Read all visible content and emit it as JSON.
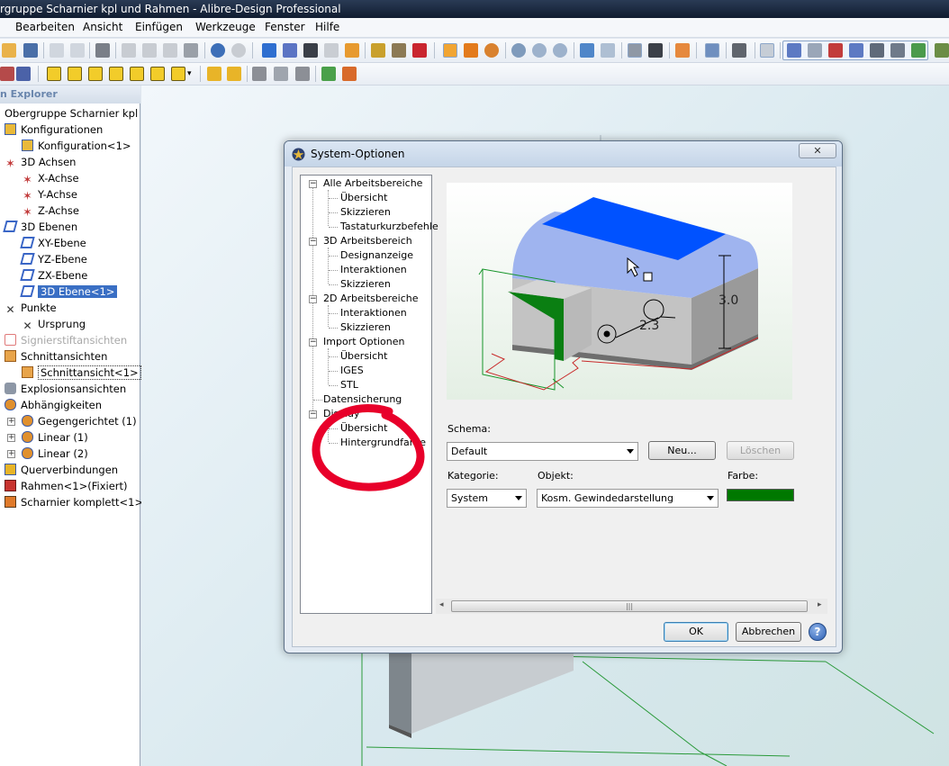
{
  "app": {
    "title": "rgruppe Scharnier kpl und Rahmen - Alibre-Design Professional"
  },
  "menu": [
    "Bearbeiten",
    "Ansicht",
    "Einfügen",
    "Werkzeuge",
    "Fenster",
    "Hilfe"
  ],
  "explorer": {
    "header": "n Explorer",
    "items": [
      {
        "label": "Obergruppe Scharnier kpl und",
        "icon": "none",
        "level": 0
      },
      {
        "label": "Konfigurationen",
        "icon": "configurations-icon",
        "level": 0
      },
      {
        "label": "Konfiguration<1>",
        "icon": "configuration-icon",
        "level": 1
      },
      {
        "label": "3D Achsen",
        "icon": "axes-icon",
        "level": 0
      },
      {
        "label": "X-Achse",
        "icon": "axis-icon",
        "level": 1
      },
      {
        "label": "Y-Achse",
        "icon": "axis-icon",
        "level": 1
      },
      {
        "label": "Z-Achse",
        "icon": "axis-icon",
        "level": 1
      },
      {
        "label": "3D Ebenen",
        "icon": "planes-icon",
        "level": 0
      },
      {
        "label": "XY-Ebene",
        "icon": "plane-icon",
        "level": 1
      },
      {
        "label": "YZ-Ebene",
        "icon": "plane-icon",
        "level": 1
      },
      {
        "label": "ZX-Ebene",
        "icon": "plane-icon",
        "level": 1
      },
      {
        "label": "3D Ebene<1>",
        "icon": "plane-icon",
        "level": 1
      },
      {
        "label": "Punkte",
        "icon": "points-icon",
        "level": 0
      },
      {
        "label": "Ursprung",
        "icon": "origin-icon",
        "level": 1
      },
      {
        "label": "Signierstiftansichten",
        "icon": "markup-icon",
        "level": 0
      },
      {
        "label": "Schnittansichten",
        "icon": "section-views-icon",
        "level": 0
      },
      {
        "label": "Schnittansicht<1>",
        "icon": "section-view-icon",
        "level": 1
      },
      {
        "label": "Explosionsansichten",
        "icon": "exploded-views-icon",
        "level": 0
      },
      {
        "label": "Abhängigkeiten",
        "icon": "constraints-icon",
        "level": 0
      },
      {
        "label": "Gegengerichtet (1)",
        "icon": "constraint-icon",
        "level": 1
      },
      {
        "label": "Linear (1)",
        "icon": "constraint-icon",
        "level": 1
      },
      {
        "label": "Linear (2)",
        "icon": "constraint-icon",
        "level": 1
      },
      {
        "label": "Querverbindungen",
        "icon": "crossref-icon",
        "level": 0
      },
      {
        "label": "Rahmen<1>(Fixiert)",
        "icon": "part-icon",
        "level": 0
      },
      {
        "label": "Scharnier komplett<1>",
        "icon": "subassembly-icon",
        "level": 0
      }
    ]
  },
  "dialog": {
    "title": "System-Optionen",
    "tree": [
      {
        "label": "Alle Arbeitsbereiche",
        "level": 0,
        "expanded": true
      },
      {
        "label": "Übersicht",
        "level": 1
      },
      {
        "label": "Skizzieren",
        "level": 1
      },
      {
        "label": "Tastaturkurzbefehle",
        "level": 1
      },
      {
        "label": "3D Arbeitsbereich",
        "level": 0,
        "expanded": true
      },
      {
        "label": "Designanzeige",
        "level": 1
      },
      {
        "label": "Interaktionen",
        "level": 1
      },
      {
        "label": "Skizzieren",
        "level": 1
      },
      {
        "label": "2D Arbeitsbereiche",
        "level": 0,
        "expanded": true
      },
      {
        "label": "Interaktionen",
        "level": 1
      },
      {
        "label": "Skizzieren",
        "level": 1
      },
      {
        "label": "Import Optionen",
        "level": 0,
        "expanded": true
      },
      {
        "label": "Übersicht",
        "level": 1
      },
      {
        "label": "IGES",
        "level": 1
      },
      {
        "label": "STL",
        "level": 1
      },
      {
        "label": "Datensicherung",
        "level": 0
      },
      {
        "label": "Display",
        "level": 0,
        "expanded": true
      },
      {
        "label": "Übersicht",
        "level": 1
      },
      {
        "label": "Hintergrundfarbe",
        "level": 1
      }
    ],
    "preview": {
      "dim1": "3.0",
      "dim2": "2.3"
    },
    "schema_label": "Schema:",
    "schema_value": "Default",
    "new_button": "Neu...",
    "delete_button": "Löschen",
    "category_label": "Kategorie:",
    "category_value": "System",
    "object_label": "Objekt:",
    "object_value": "Kosm. Gewindedarstellung",
    "color_label": "Farbe:",
    "color_value": "#007800",
    "ok_button": "OK",
    "cancel_button": "Abbrechen",
    "help_button": "?"
  },
  "colors": {
    "annotation_circle": "#e8002a",
    "selection": "#3a6fc4",
    "preview_top": "#0055ff"
  }
}
